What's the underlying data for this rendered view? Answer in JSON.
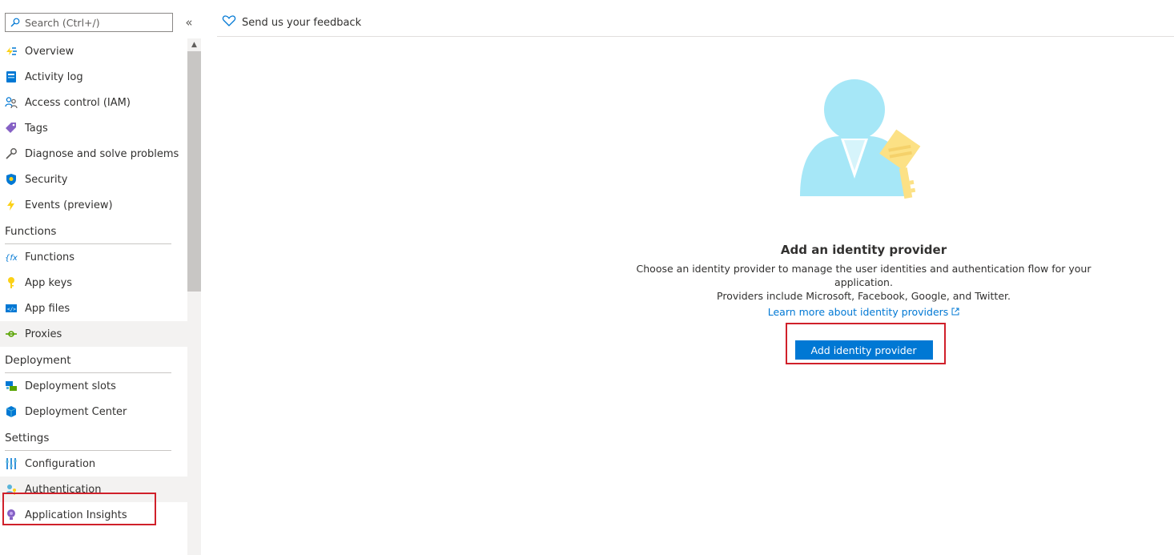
{
  "sidebar": {
    "search_placeholder": "Search (Ctrl+/)",
    "collapse_glyph": "«",
    "items_top": [
      {
        "label": "Overview",
        "icon": "overview-icon"
      },
      {
        "label": "Activity log",
        "icon": "activity-log-icon"
      },
      {
        "label": "Access control (IAM)",
        "icon": "access-control-icon"
      },
      {
        "label": "Tags",
        "icon": "tag-icon"
      },
      {
        "label": "Diagnose and solve problems",
        "icon": "wrench-icon"
      },
      {
        "label": "Security",
        "icon": "shield-icon"
      },
      {
        "label": "Events (preview)",
        "icon": "lightning-icon"
      }
    ],
    "sections": [
      {
        "title": "Functions",
        "items": [
          {
            "label": "Functions",
            "icon": "function-icon"
          },
          {
            "label": "App keys",
            "icon": "key-icon"
          },
          {
            "label": "App files",
            "icon": "app-files-icon"
          },
          {
            "label": "Proxies",
            "icon": "proxy-icon",
            "selected": true
          }
        ]
      },
      {
        "title": "Deployment",
        "items": [
          {
            "label": "Deployment slots",
            "icon": "deployment-slots-icon"
          },
          {
            "label": "Deployment Center",
            "icon": "cube-icon"
          }
        ]
      },
      {
        "title": "Settings",
        "items": [
          {
            "label": "Configuration",
            "icon": "sliders-icon"
          },
          {
            "label": "Authentication",
            "icon": "authentication-icon",
            "selected": true
          },
          {
            "label": "Application Insights",
            "icon": "lightbulb-icon"
          }
        ]
      }
    ]
  },
  "toolbar": {
    "feedback_label": "Send us your feedback"
  },
  "empty_state": {
    "title": "Add an identity provider",
    "description_line1": "Choose an identity provider to manage the user identities and authentication flow for your application.",
    "description_line2": "Providers include Microsoft, Facebook, Google, and Twitter.",
    "link_label": "Learn more about identity providers",
    "button_label": "Add identity provider"
  },
  "colors": {
    "accent": "#0078d4",
    "highlight": "#d0202a",
    "selected_bg": "#f3f2f1"
  }
}
